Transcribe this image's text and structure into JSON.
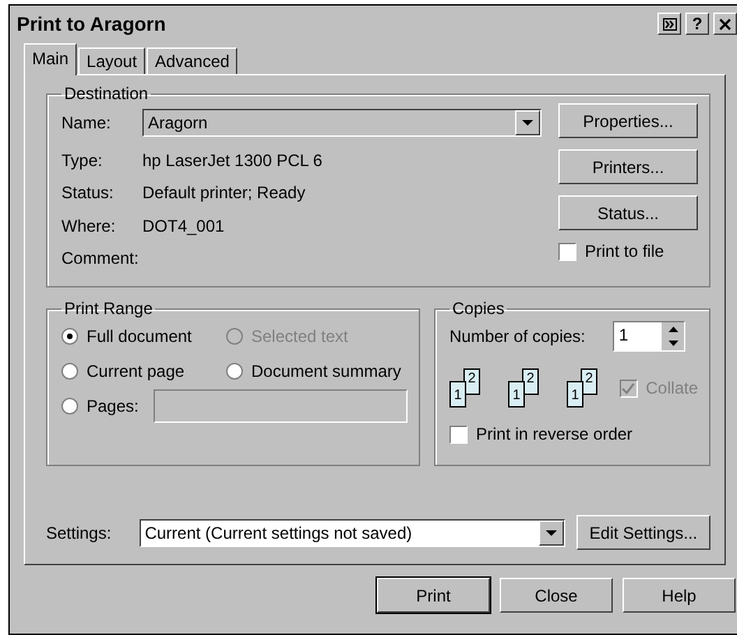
{
  "window": {
    "title": "Print to Aragorn",
    "title_buttons": [
      {
        "kind": "expand"
      },
      {
        "kind": "help",
        "label": "?"
      },
      {
        "kind": "close"
      }
    ]
  },
  "tabs": [
    {
      "label": "Main",
      "selected": true
    },
    {
      "label": "Layout",
      "selected": false
    },
    {
      "label": "Advanced",
      "selected": false
    }
  ],
  "destination": {
    "title": "Destination",
    "name_label": "Name:",
    "name_value": "Aragorn",
    "info": [
      {
        "label": "Type:",
        "value": "hp LaserJet 1300 PCL 6"
      },
      {
        "label": "Status:",
        "value": "Default printer; Ready"
      },
      {
        "label": "Where:",
        "value": "DOT4_001"
      },
      {
        "label": "Comment:"
      }
    ],
    "buttons": [
      "Properties...",
      "Printers...",
      "Status..."
    ],
    "print_to_file": {
      "label": "Print to file",
      "checked": false
    }
  },
  "print_range": {
    "title": "Print Range",
    "options": [
      {
        "label": "Full document",
        "selected": true,
        "disabled": false
      },
      {
        "label": "Selected text",
        "selected": false,
        "disabled": true
      },
      {
        "label": "Current page",
        "selected": false,
        "disabled": false
      },
      {
        "label": "Document summary",
        "selected": false,
        "disabled": false
      },
      {
        "label": "Pages:",
        "selected": false,
        "disabled": false
      }
    ]
  },
  "copies": {
    "title": "Copies",
    "number_label": "Number of copies:",
    "number_value": "1",
    "collate_icons": [
      {
        "front": "1",
        "back": "2"
      },
      {
        "front": "1",
        "back": "2"
      },
      {
        "front": "1",
        "back": "2"
      }
    ],
    "collate": {
      "label": "Collate",
      "checked": true,
      "disabled": true
    },
    "reverse": {
      "label": "Print in reverse order",
      "checked": false
    }
  },
  "settings": {
    "label": "Settings:",
    "value": "Current (Current settings not saved)",
    "button": "Edit Settings..."
  },
  "buttons": [
    {
      "label": "Print",
      "default": true
    },
    {
      "label": "Close",
      "default": false
    },
    {
      "label": "Help",
      "default": false
    }
  ]
}
